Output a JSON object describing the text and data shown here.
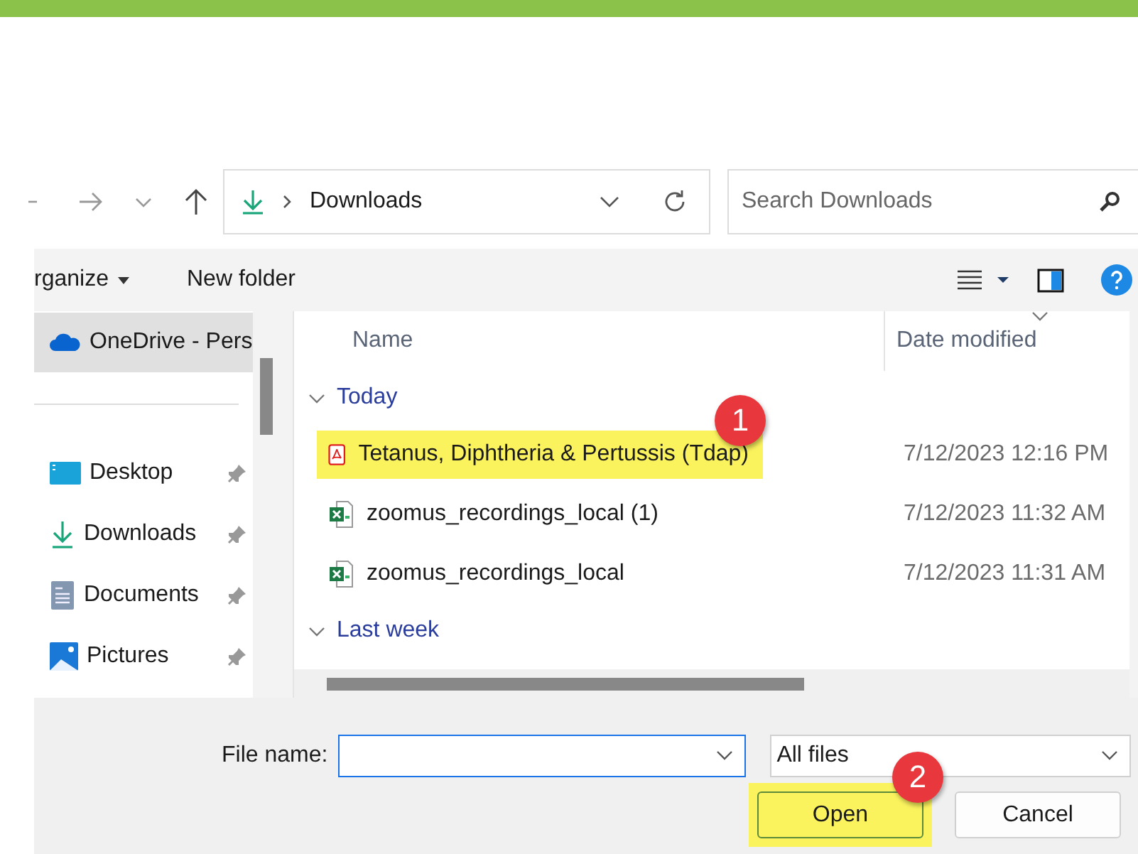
{
  "nav": {
    "breadcrumb": "Downloads",
    "search": {
      "placeholder": "Search Downloads"
    }
  },
  "toolbar": {
    "organize": "rganize",
    "new_folder": "New folder"
  },
  "sidebar": {
    "items": [
      {
        "label": "OneDrive - Pers",
        "kind": "cloud",
        "selected": true,
        "pinned": false
      },
      {
        "label": "Desktop",
        "kind": "desktop",
        "selected": false,
        "pinned": true
      },
      {
        "label": "Downloads",
        "kind": "download",
        "selected": false,
        "pinned": true
      },
      {
        "label": "Documents",
        "kind": "document",
        "selected": false,
        "pinned": true
      },
      {
        "label": "Pictures",
        "kind": "pictures",
        "selected": false,
        "pinned": true
      }
    ]
  },
  "file_list": {
    "columns": [
      "Name",
      "Date modified"
    ],
    "groups": [
      {
        "label": "Today",
        "expanded": true,
        "files": [
          {
            "name": "Tetanus, Diphtheria & Pertussis (Tdap)",
            "date": "7/12/2023 12:16 PM",
            "kind": "pdf",
            "highlighted": true,
            "badge": "1"
          },
          {
            "name": "zoomus_recordings_local (1)",
            "date": "7/12/2023 11:32 AM",
            "kind": "excel",
            "highlighted": false
          },
          {
            "name": "zoomus_recordings_local",
            "date": "7/12/2023 11:31 AM",
            "kind": "excel",
            "highlighted": false
          }
        ]
      },
      {
        "label": "Last week",
        "expanded": true
      }
    ]
  },
  "footer": {
    "file_name_label": "File name:",
    "file_type": "All files",
    "buttons": [
      {
        "label": "Open",
        "highlighted": true,
        "badge": "2"
      },
      {
        "label": "Cancel",
        "highlighted": false
      }
    ]
  }
}
